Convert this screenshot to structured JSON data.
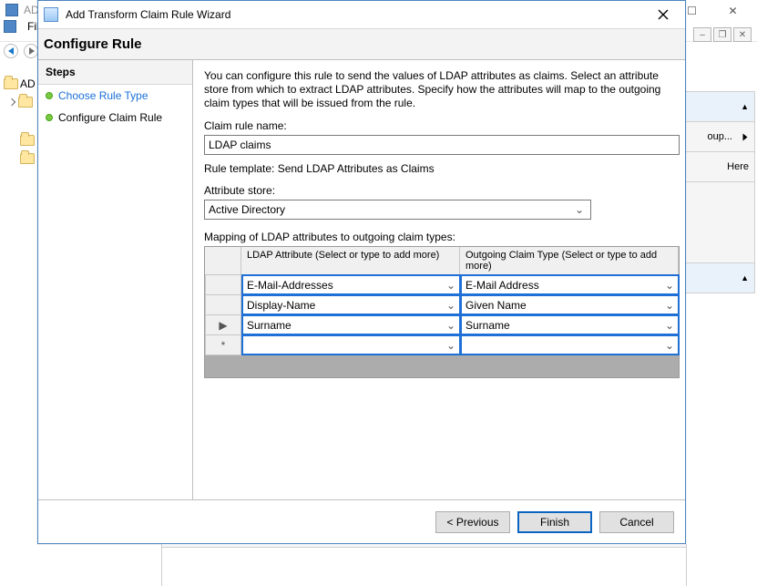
{
  "background": {
    "title_fragment": "AD",
    "menu_file": "File",
    "tree_root_label": "AD",
    "actions": {
      "header_suffix": "▲",
      "item1_suffix": "oup...",
      "item2_suffix": "Here"
    },
    "sys": {
      "min": "—",
      "max": "☐",
      "close": "✕"
    },
    "mdi": {
      "min": "–",
      "restore": "❐",
      "close": "✕"
    }
  },
  "dialog": {
    "title": "Add Transform Claim Rule Wizard",
    "page_title": "Configure Rule",
    "steps_heading": "Steps",
    "steps": [
      {
        "label": "Choose Rule Type",
        "current": false
      },
      {
        "label": "Configure Claim Rule",
        "current": true
      }
    ],
    "description": "You can configure this rule to send the values of LDAP attributes as claims. Select an attribute store from which to extract LDAP attributes. Specify how the attributes will map to the outgoing claim types that will be issued from the rule.",
    "claim_rule_name_label": "Claim rule name:",
    "claim_rule_name_value": "LDAP claims",
    "rule_template_label": "Rule template: Send LDAP Attributes as Claims",
    "attribute_store_label": "Attribute store:",
    "attribute_store_value": "Active Directory",
    "mapping_label": "Mapping of LDAP attributes to outgoing claim types:",
    "grid": {
      "rowheader_current_marker": "▶",
      "rowheader_new_marker": "*",
      "col1": "LDAP Attribute (Select or type to add more)",
      "col2": "Outgoing Claim Type (Select or type to add more)",
      "rows": [
        {
          "ldap": "E-Mail-Addresses",
          "claim": "E-Mail Address",
          "marker": ""
        },
        {
          "ldap": "Display-Name",
          "claim": "Given Name",
          "marker": ""
        },
        {
          "ldap": "Surname",
          "claim": "Surname",
          "marker": "▶"
        },
        {
          "ldap": "",
          "claim": "",
          "marker": "*"
        }
      ]
    },
    "buttons": {
      "previous": "< Previous",
      "finish": "Finish",
      "cancel": "Cancel"
    }
  }
}
